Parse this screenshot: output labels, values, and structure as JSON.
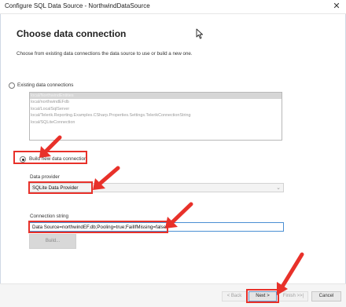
{
  "window": {
    "title": "Configure SQL Data Source - NorthwindDataSource",
    "close_glyph": "✕"
  },
  "page": {
    "heading": "Choose data connection",
    "instructions": "Choose from existing data connections the data source to use or build a new one."
  },
  "existing": {
    "label": "Existing data connections",
    "selected": false,
    "items": [
      "local/NorthwindEntities",
      "local/northwindEFdb",
      "local/LocalSqlServer",
      "local/Telerik.Reporting.Examples.CSharp.Properties.Settings.TelerikConnectionString",
      "local/SQLiteConnection"
    ]
  },
  "build_new": {
    "label": "Build new data connection",
    "selected": true
  },
  "provider": {
    "label": "Data provider",
    "value": "SQLite Data Provider"
  },
  "connection": {
    "label": "Connection string",
    "value": "Data Source=northwindEF.db;Pooling=true;FailIfMissing=false"
  },
  "buttons": {
    "build": "Build...",
    "back": "< Back",
    "next": "Next >",
    "finish": "Finish >>|",
    "cancel": "Cancel"
  },
  "colors": {
    "annotation": "#e8312a",
    "focus": "#4a8fd3"
  }
}
